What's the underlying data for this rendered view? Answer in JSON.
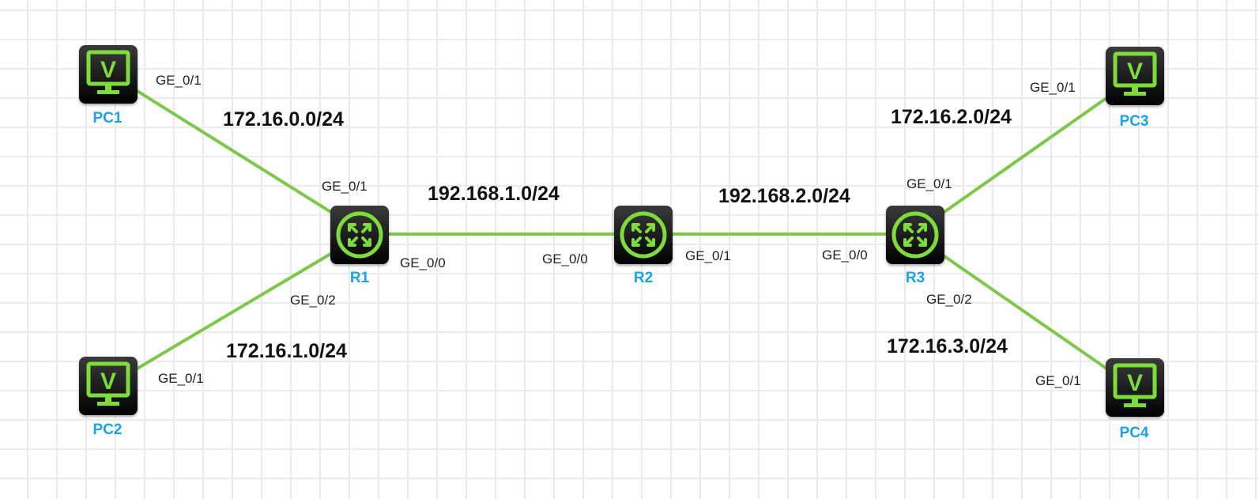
{
  "colors": {
    "link": "#7dc84a",
    "device_label": "#1aa3e6",
    "icon_green": "#7ddc3c",
    "grid": "#ebebeb"
  },
  "devices": {
    "pc1": {
      "name": "PC1",
      "icon": "monitor-icon"
    },
    "pc2": {
      "name": "PC2",
      "icon": "monitor-icon"
    },
    "pc3": {
      "name": "PC3",
      "icon": "monitor-icon"
    },
    "pc4": {
      "name": "PC4",
      "icon": "monitor-icon"
    },
    "r1": {
      "name": "R1",
      "icon": "router-icon"
    },
    "r2": {
      "name": "R2",
      "icon": "router-icon"
    },
    "r3": {
      "name": "R3",
      "icon": "router-icon"
    }
  },
  "ports": {
    "pc1_ge01": "GE_0/1",
    "pc2_ge01": "GE_0/1",
    "pc3_ge01": "GE_0/1",
    "pc4_ge01": "GE_0/1",
    "r1_ge01": "GE_0/1",
    "r1_ge00": "GE_0/0",
    "r1_ge02": "GE_0/2",
    "r2_ge00": "GE_0/0",
    "r2_ge01": "GE_0/1",
    "r3_ge00": "GE_0/0",
    "r3_ge01": "GE_0/1",
    "r3_ge02": "GE_0/2"
  },
  "subnets": {
    "pc1_r1": "172.16.0.0/24",
    "pc2_r1": "172.16.1.0/24",
    "r1_r2": "192.168.1.0/24",
    "r2_r3": "192.168.2.0/24",
    "r3_pc3": "172.16.2.0/24",
    "r3_pc4": "172.16.3.0/24"
  }
}
